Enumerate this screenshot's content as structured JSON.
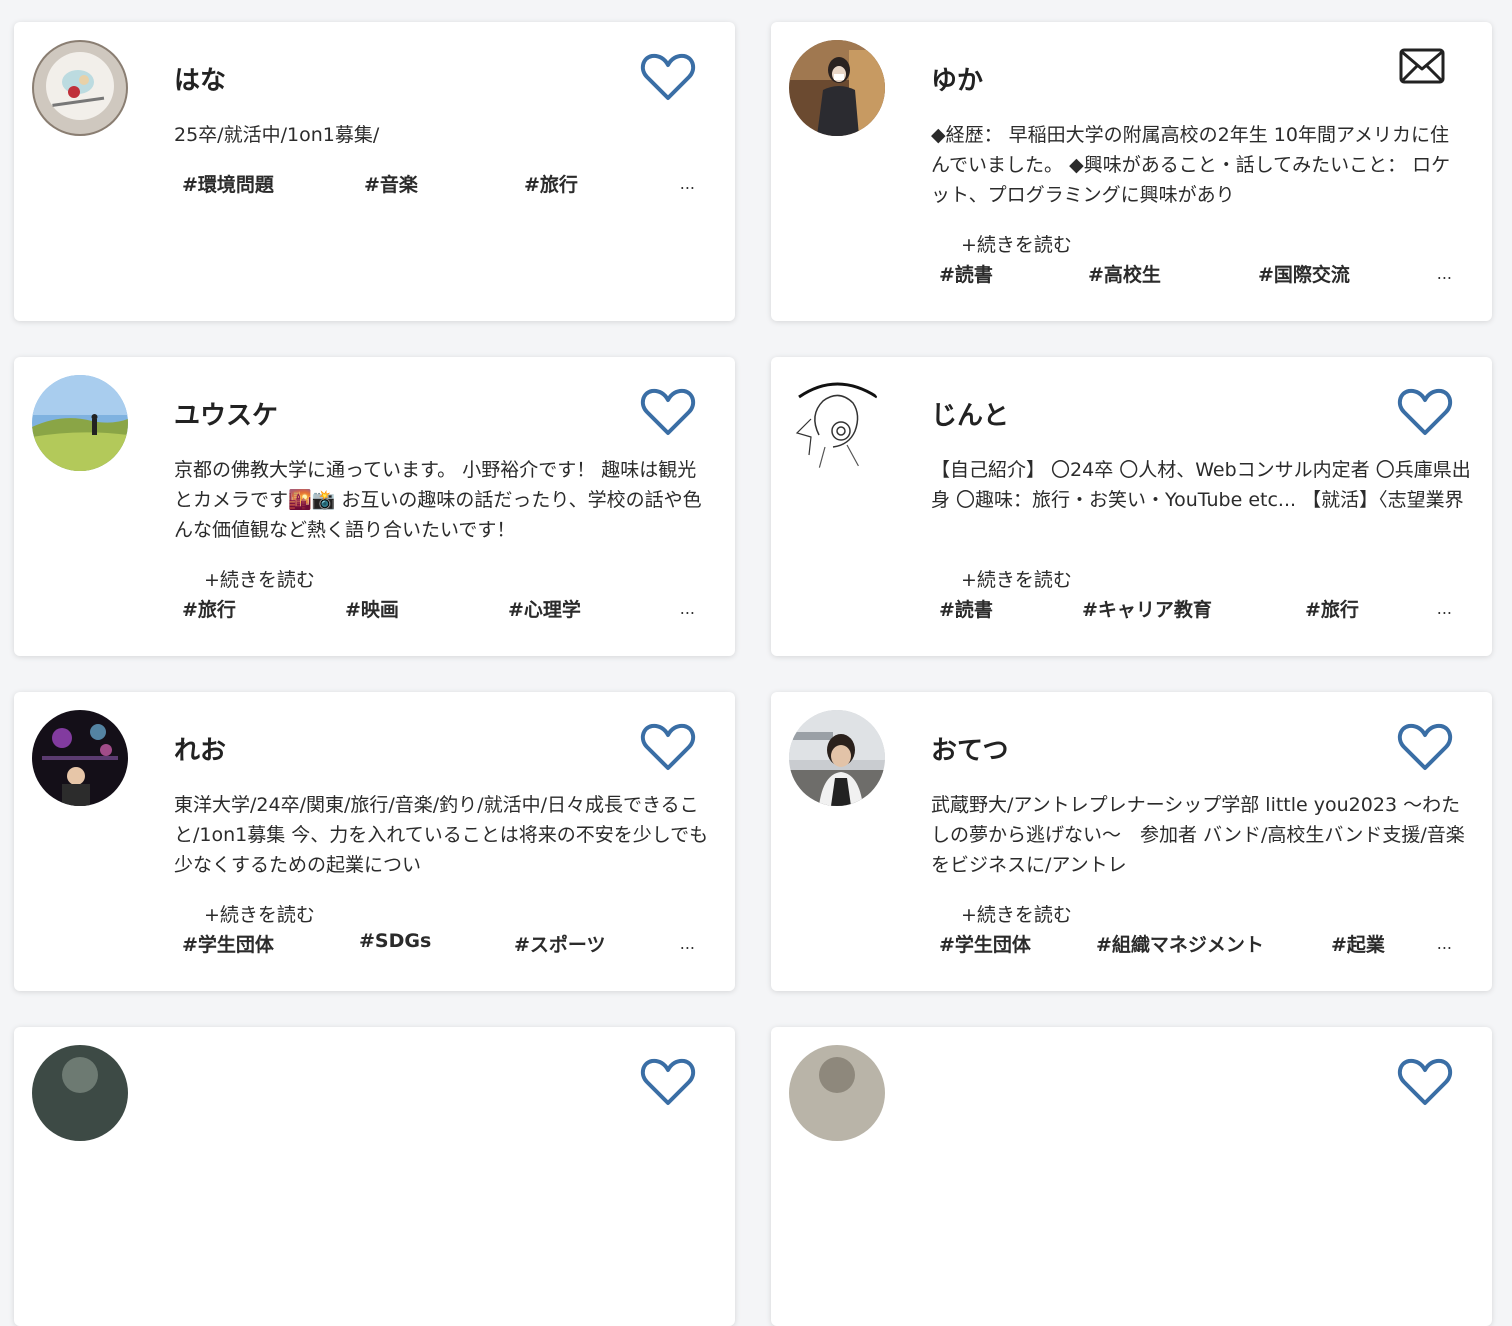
{
  "cards": [
    {
      "name": "はな",
      "bio": "25卒/就活中/1on1募集/",
      "read_more": "",
      "tags": [
        "#環境問題",
        "#音楽",
        "#旅行"
      ],
      "more": "...",
      "action_icon": "heart-outline-icon"
    },
    {
      "name": "ゆか",
      "bio": "◆経歴： 早稲田大学の附属高校の2年生 10年間アメリカに住んでいました。 ◆興味があること・話してみたいこと： ロケット、プログラミングに興味があり",
      "read_more": "+続きを読む",
      "tags": [
        "#読書",
        "#高校生",
        "#国際交流"
      ],
      "more": "...",
      "action_icon": "envelope-icon"
    },
    {
      "name": "ユウスケ",
      "bio": "京都の佛教大学に通っています。 小野裕介です！ 趣味は観光とカメラです🌇📸 お互いの趣味の話だったり、学校の話や色んな価値観など熱く語り合いたいです！",
      "read_more": "+続きを読む",
      "tags": [
        "#旅行",
        "#映画",
        "#心理学"
      ],
      "more": "...",
      "action_icon": "heart-outline-icon"
    },
    {
      "name": "じんと",
      "bio": "【自己紹介】 〇24卒 〇人材、Webコンサル内定者 〇兵庫県出身 〇趣味：旅行・お笑い・YouTube etc... 【就活】〈志望業界",
      "read_more": "+続きを読む",
      "tags": [
        "#読書",
        "#キャリア教育",
        "#旅行"
      ],
      "more": "...",
      "action_icon": "heart-outline-icon"
    },
    {
      "name": "れお",
      "bio": "東洋大学/24卒/関東/旅行/音楽/釣り/就活中/日々成長できること/1on1募集 今、力を入れていることは将来の不安を少しでも少なくするための起業につい",
      "read_more": "+続きを読む",
      "tags": [
        "#学生団体",
        "#SDGs",
        "#スポーツ"
      ],
      "more": "...",
      "action_icon": "heart-outline-icon"
    },
    {
      "name": "おてつ",
      "bio": "武蔵野大/アントレプレナーシップ学部 little you2023 〜わたしの夢から逃げない〜　参加者 バンド/高校生バンド支援/音楽をビジネスに/アントレ",
      "read_more": "+続きを読む",
      "tags": [
        "#学生団体",
        "#組織マネジメント",
        "#起業"
      ],
      "more": "...",
      "action_icon": "heart-outline-icon"
    }
  ],
  "colors": {
    "accent": "#3a6ea5",
    "background": "#f4f5f7",
    "card": "#ffffff"
  }
}
